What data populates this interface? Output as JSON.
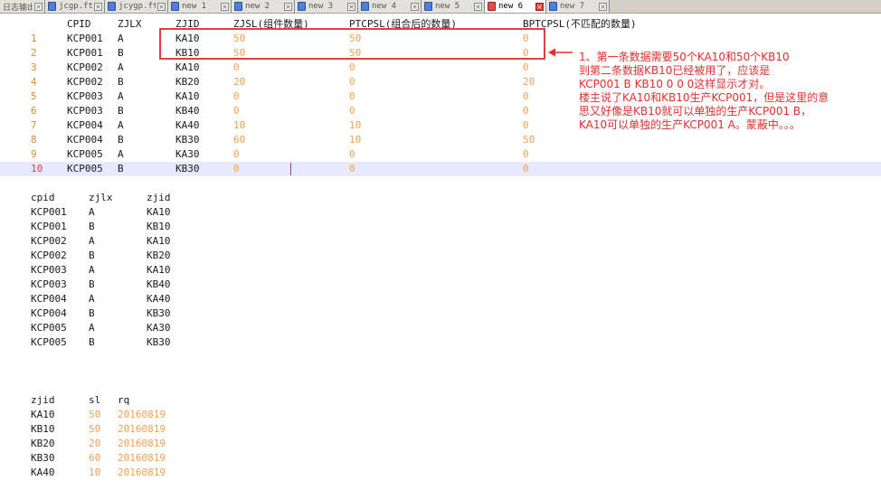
{
  "tabs": [
    {
      "label": "日志输出.txt",
      "active": false
    },
    {
      "label": "jcgp.ftl",
      "active": false
    },
    {
      "label": "jcygp.ftl",
      "active": false
    },
    {
      "label": "new 1",
      "active": false
    },
    {
      "label": "new 2",
      "active": false
    },
    {
      "label": "new 3",
      "active": false
    },
    {
      "label": "new 4",
      "active": false
    },
    {
      "label": "new 5",
      "active": false
    },
    {
      "label": "new 6",
      "active": true
    },
    {
      "label": "new 7",
      "active": false
    }
  ],
  "table1": {
    "headers": [
      "CPID",
      "ZJLX",
      "ZJID",
      "ZJSL(组件数量)",
      "PTCPSL(组合后的数量)",
      "BPTCPSL(不匹配的数量)"
    ],
    "rows": [
      {
        "ln": "1",
        "cells": [
          "KCP001",
          "A",
          "KA10",
          "50",
          "50",
          "0"
        ]
      },
      {
        "ln": "2",
        "cells": [
          "KCP001",
          "B",
          "KB10",
          "50",
          "50",
          "0"
        ]
      },
      {
        "ln": "3",
        "cells": [
          "KCP002",
          "A",
          "KA10",
          "0",
          "0",
          "0"
        ]
      },
      {
        "ln": "4",
        "cells": [
          "KCP002",
          "B",
          "KB20",
          "20",
          "0",
          "20"
        ]
      },
      {
        "ln": "5",
        "cells": [
          "KCP003",
          "A",
          "KA10",
          "0",
          "0",
          "0"
        ]
      },
      {
        "ln": "6",
        "cells": [
          "KCP003",
          "B",
          "KB40",
          "0",
          "0",
          "0"
        ]
      },
      {
        "ln": "7",
        "cells": [
          "KCP004",
          "A",
          "KA40",
          "10",
          "10",
          "0"
        ]
      },
      {
        "ln": "8",
        "cells": [
          "KCP004",
          "B",
          "KB30",
          "60",
          "10",
          "50"
        ]
      },
      {
        "ln": "9",
        "cells": [
          "KCP005",
          "A",
          "KA30",
          "0",
          "0",
          "0"
        ]
      },
      {
        "ln": "10",
        "cells": [
          "KCP005",
          "B",
          "KB30",
          "0",
          "0",
          "0"
        ]
      }
    ]
  },
  "table2": {
    "headers": [
      "cpid",
      "zjlx",
      "zjid"
    ],
    "rows": [
      [
        "KCP001",
        "A",
        "KA10"
      ],
      [
        "KCP001",
        "B",
        "KB10"
      ],
      [
        "KCP002",
        "A",
        "KA10"
      ],
      [
        "KCP002",
        "B",
        "KB20"
      ],
      [
        "KCP003",
        "A",
        "KA10"
      ],
      [
        "KCP003",
        "B",
        "KB40"
      ],
      [
        "KCP004",
        "A",
        "KA40"
      ],
      [
        "KCP004",
        "B",
        "KB30"
      ],
      [
        "KCP005",
        "A",
        "KA30"
      ],
      [
        "KCP005",
        "B",
        "KB30"
      ]
    ]
  },
  "table3": {
    "headers": [
      "zjid",
      "sl",
      "rq"
    ],
    "rows": [
      [
        "KA10",
        "50",
        "20160819"
      ],
      [
        "KB10",
        "50",
        "20160819"
      ],
      [
        "KB20",
        "20",
        "20160819"
      ],
      [
        "KB30",
        "60",
        "20160819"
      ],
      [
        "KA40",
        "10",
        "20160819"
      ]
    ]
  },
  "annotation": {
    "lines": [
      "1、第一条数据需要50个KA10和50个KB10",
      "到第二条数据KB10已经被用了，应该是",
      "KCP001 B  KB10   0   0   0这样显示才对。",
      "楼主说了KA10和KB10生产KCP001，但是这里的意",
      "思又好像是KB10就可以单独的生产KCP001 B，",
      "KA10可以单独的生产KCP001 A。蒙蔽中。。。"
    ]
  },
  "colors": {
    "line_number": "#e08a2f",
    "number_literal": "#f0a050",
    "annotation": "#e03030",
    "current_line": "#e8e8ff"
  }
}
